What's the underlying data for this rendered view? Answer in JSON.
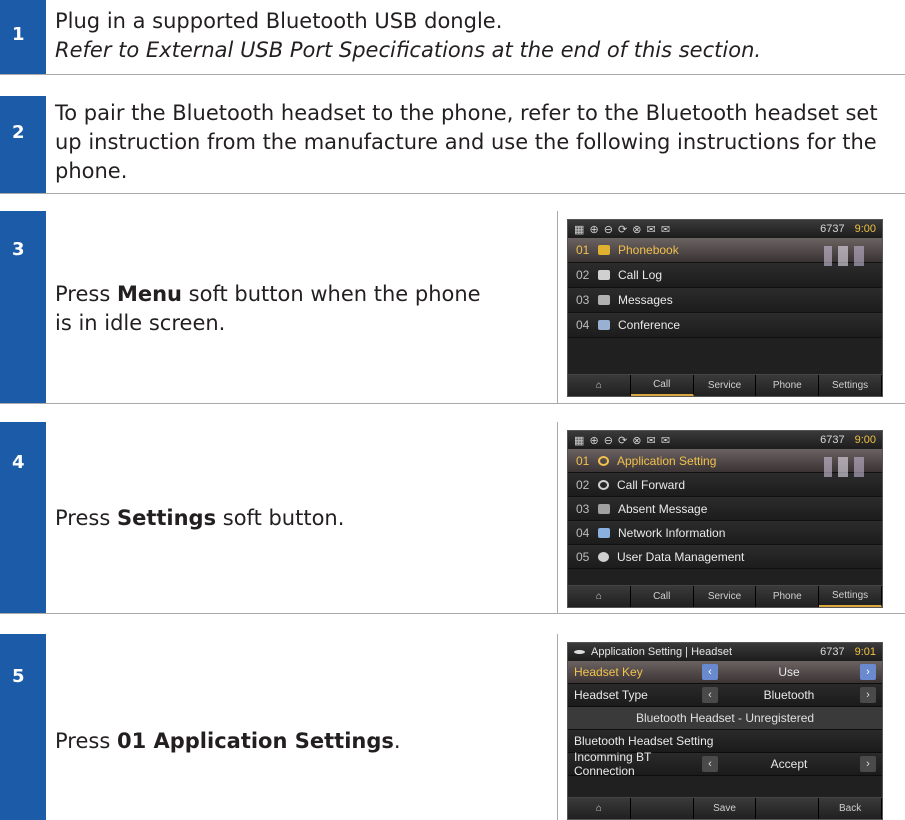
{
  "steps": [
    {
      "number": "1",
      "text": "Plug in a supported Bluetooth USB dongle.",
      "note": "Refer to External USB Port Specifications at the end of this section."
    },
    {
      "number": "2",
      "text": "To pair the Bluetooth headset to the phone, refer to the Bluetooth headset set up instruction from the manufacture and use the following instructions for the phone."
    },
    {
      "number": "3",
      "text_before": "Press ",
      "bold": "Menu",
      "text_after": " soft button when the phone is in idle screen."
    },
    {
      "number": "4",
      "text_before": "Press ",
      "bold": "Settings",
      "text_after": " soft button."
    },
    {
      "number": "5",
      "text_before": "Press ",
      "bold": "01 Application Settings",
      "text_after": "."
    }
  ],
  "phone_menu": {
    "status_icons": "▦ ⊕ ⊖ ⟳ ⊗ ✉ ✉",
    "extension": "6737",
    "time": "9:00",
    "items": [
      {
        "idx": "01",
        "label": "Phonebook",
        "icon": "phonebook-icon"
      },
      {
        "idx": "02",
        "label": "Call Log",
        "icon": "call-log-icon"
      },
      {
        "idx": "03",
        "label": "Messages",
        "icon": "messages-icon"
      },
      {
        "idx": "04",
        "label": "Conference",
        "icon": "conference-icon"
      }
    ],
    "tabs": [
      "⌂",
      "Call",
      "Service",
      "Phone",
      "Settings"
    ]
  },
  "phone_settings": {
    "status_icons": "▦ ⊕ ⊖ ⟳ ⊗ ✉ ✉",
    "extension": "6737",
    "time": "9:00",
    "items": [
      {
        "idx": "01",
        "label": "Application Setting",
        "icon": "gear-icon"
      },
      {
        "idx": "02",
        "label": "Call Forward",
        "icon": "call-forward-icon"
      },
      {
        "idx": "03",
        "label": "Absent Message",
        "icon": "absent-message-icon"
      },
      {
        "idx": "04",
        "label": "Network Information",
        "icon": "network-icon"
      },
      {
        "idx": "05",
        "label": "User Data Management",
        "icon": "user-data-icon"
      }
    ],
    "tabs": [
      "⌂",
      "Call",
      "Service",
      "Phone",
      "Settings"
    ]
  },
  "phone_headset": {
    "title": "Application Setting | Headset",
    "extension": "6737",
    "time": "9:01",
    "rows": [
      {
        "label": "Headset Key",
        "value": "Use"
      },
      {
        "label": "Headset Type",
        "value": "Bluetooth"
      }
    ],
    "banner": "Bluetooth Headset - Unregistered",
    "section": "Bluetooth Headset Setting",
    "incoming": {
      "label": "Incomming BT Connection",
      "value": "Accept"
    },
    "softkeys": [
      "⌂",
      "",
      "Save",
      "",
      "Back"
    ]
  }
}
